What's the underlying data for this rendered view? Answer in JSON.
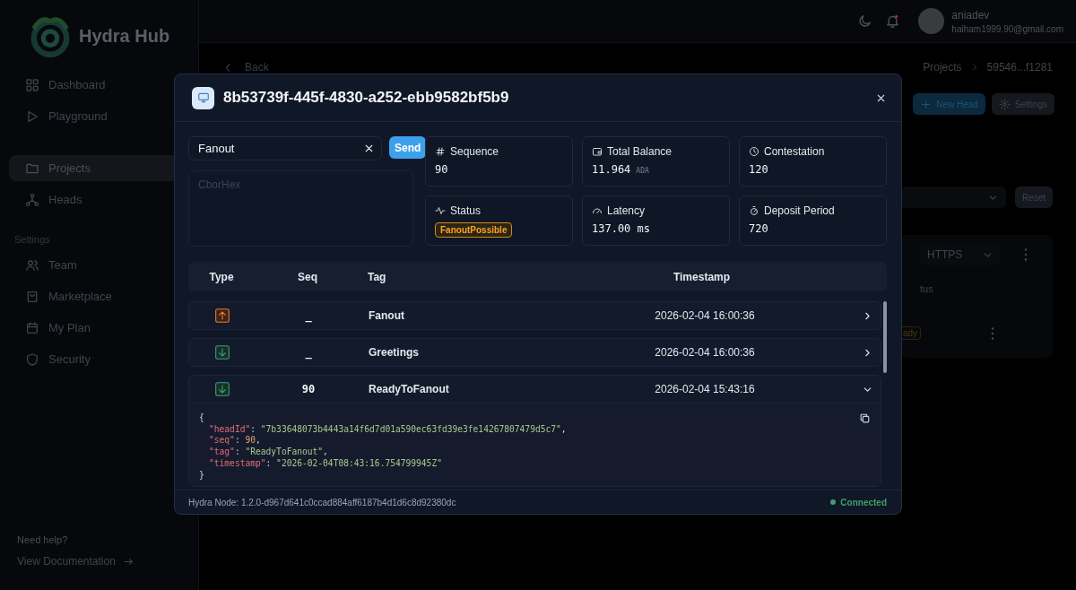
{
  "sidebar": {
    "brand": "Hydra Hub",
    "items": [
      {
        "label": "Dashboard",
        "selected": false
      },
      {
        "label": "Playground",
        "selected": false
      },
      {
        "label": "Projects",
        "selected": true
      },
      {
        "label": "Heads",
        "selected": false
      }
    ],
    "section": "Settings",
    "settings_items": [
      {
        "label": "Team",
        "selected": false
      },
      {
        "label": "Marketplace",
        "selected": false
      },
      {
        "label": "My Plan",
        "selected": false
      },
      {
        "label": "Security",
        "selected": false
      }
    ],
    "help": "Need help?",
    "docs_link": "View Documentation"
  },
  "topbar": {
    "user_name": "aniadev",
    "user_email": "haiham1999.90@gmail.com",
    "notification_unread": true
  },
  "page": {
    "back": "Back",
    "breadcrumb": [
      "Projects",
      "59546...f1281"
    ],
    "new_head_button": "New Head",
    "settings_button": "Settings",
    "reset_button": "Reset",
    "protocol_select": "HTTPS",
    "column_partial": "tus",
    "badge_partial": "ady"
  },
  "modal": {
    "title": "8b53739f-445f-4830-a252-ebb9582bf5b9",
    "command": {
      "value": "Fanout",
      "send": "Send",
      "cbor_placeholder": "CborHex"
    },
    "stats": [
      {
        "label": "Sequence",
        "kind": "value",
        "value": "90"
      },
      {
        "label": "Total Balance",
        "kind": "value",
        "value": "11.964",
        "unit": "ADA"
      },
      {
        "label": "Contestation",
        "kind": "value",
        "value": "120"
      },
      {
        "label": "Status",
        "kind": "badge",
        "value": "FanoutPossible"
      },
      {
        "label": "Latency",
        "kind": "value",
        "value": "137.00 ms"
      },
      {
        "label": "Deposit Period",
        "kind": "value",
        "value": "720"
      }
    ],
    "table": {
      "columns": [
        "Type",
        "Seq",
        "Tag",
        "Timestamp"
      ],
      "rows": [
        {
          "kind": "outgoing",
          "seq": "_",
          "tag": "Fanout",
          "timestamp": "2026-02-04 16:00:36",
          "expanded": false
        },
        {
          "kind": "incoming",
          "seq": "_",
          "tag": "Greetings",
          "timestamp": "2026-02-04 16:00:36",
          "expanded": false
        },
        {
          "kind": "incoming",
          "seq": "90",
          "tag": "ReadyToFanout",
          "timestamp": "2026-02-04 15:43:16",
          "expanded": true,
          "detail": {
            "open": "{",
            "close": "}",
            "fields": [
              {
                "key": "\"headId\"",
                "sep": ": ",
                "value": "\"7b33648073b4443a14f6d7d01a590ec63fd39e3fe14267807479d5c7\"",
                "kind": "string",
                "end": ","
              },
              {
                "key": "\"seq\"",
                "sep": ": ",
                "value": "90",
                "kind": "number",
                "end": ","
              },
              {
                "key": "\"tag\"",
                "sep": ": ",
                "value": "\"ReadyToFanout\"",
                "kind": "string",
                "end": ","
              },
              {
                "key": "\"timestamp\"",
                "sep": ": ",
                "value": "\"2026-02-04T08:43:16.754799945Z\"",
                "kind": "string"
              }
            ]
          }
        }
      ]
    },
    "footer": {
      "node": "Hydra Node: 1.2.0-d967d641c0ccad884aff6187b4d1d6c8d92380dc",
      "connection": "Connected",
      "connected": true
    }
  }
}
